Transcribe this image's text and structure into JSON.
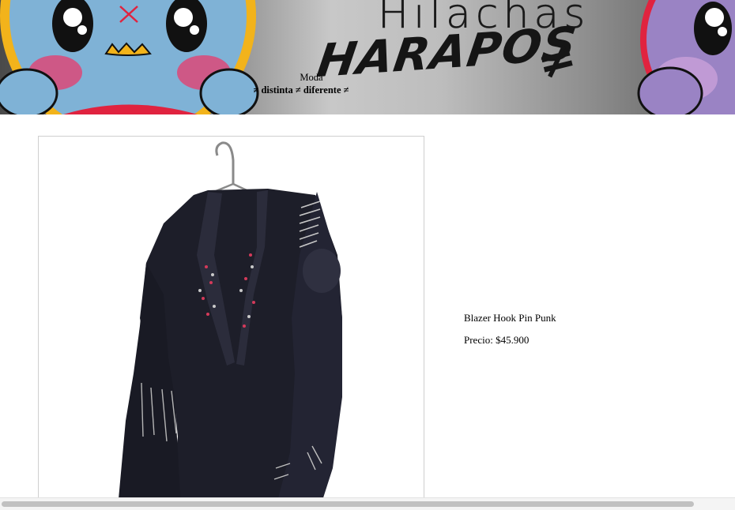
{
  "banner": {
    "logo_top": "Hilachas",
    "logo_main": "HARAPOS",
    "logo_symbol": "≠",
    "tagline_line1": "Moda",
    "tagline_line2": "≠ distinta ≠ diferente ≠",
    "mascot_colors": {
      "left_body": "#7fb2d6",
      "left_ring": "#f2b31b",
      "right_body": "#9a83c4",
      "right_ring": "#e0233f",
      "cheek": "#e83a6b"
    }
  },
  "product": {
    "name": "Blazer Hook Pin Punk",
    "price_text": "Precio: $45.900",
    "image_icon": "blazer-photo"
  },
  "scrollbar": {
    "orientation": "horizontal",
    "position": 0
  }
}
